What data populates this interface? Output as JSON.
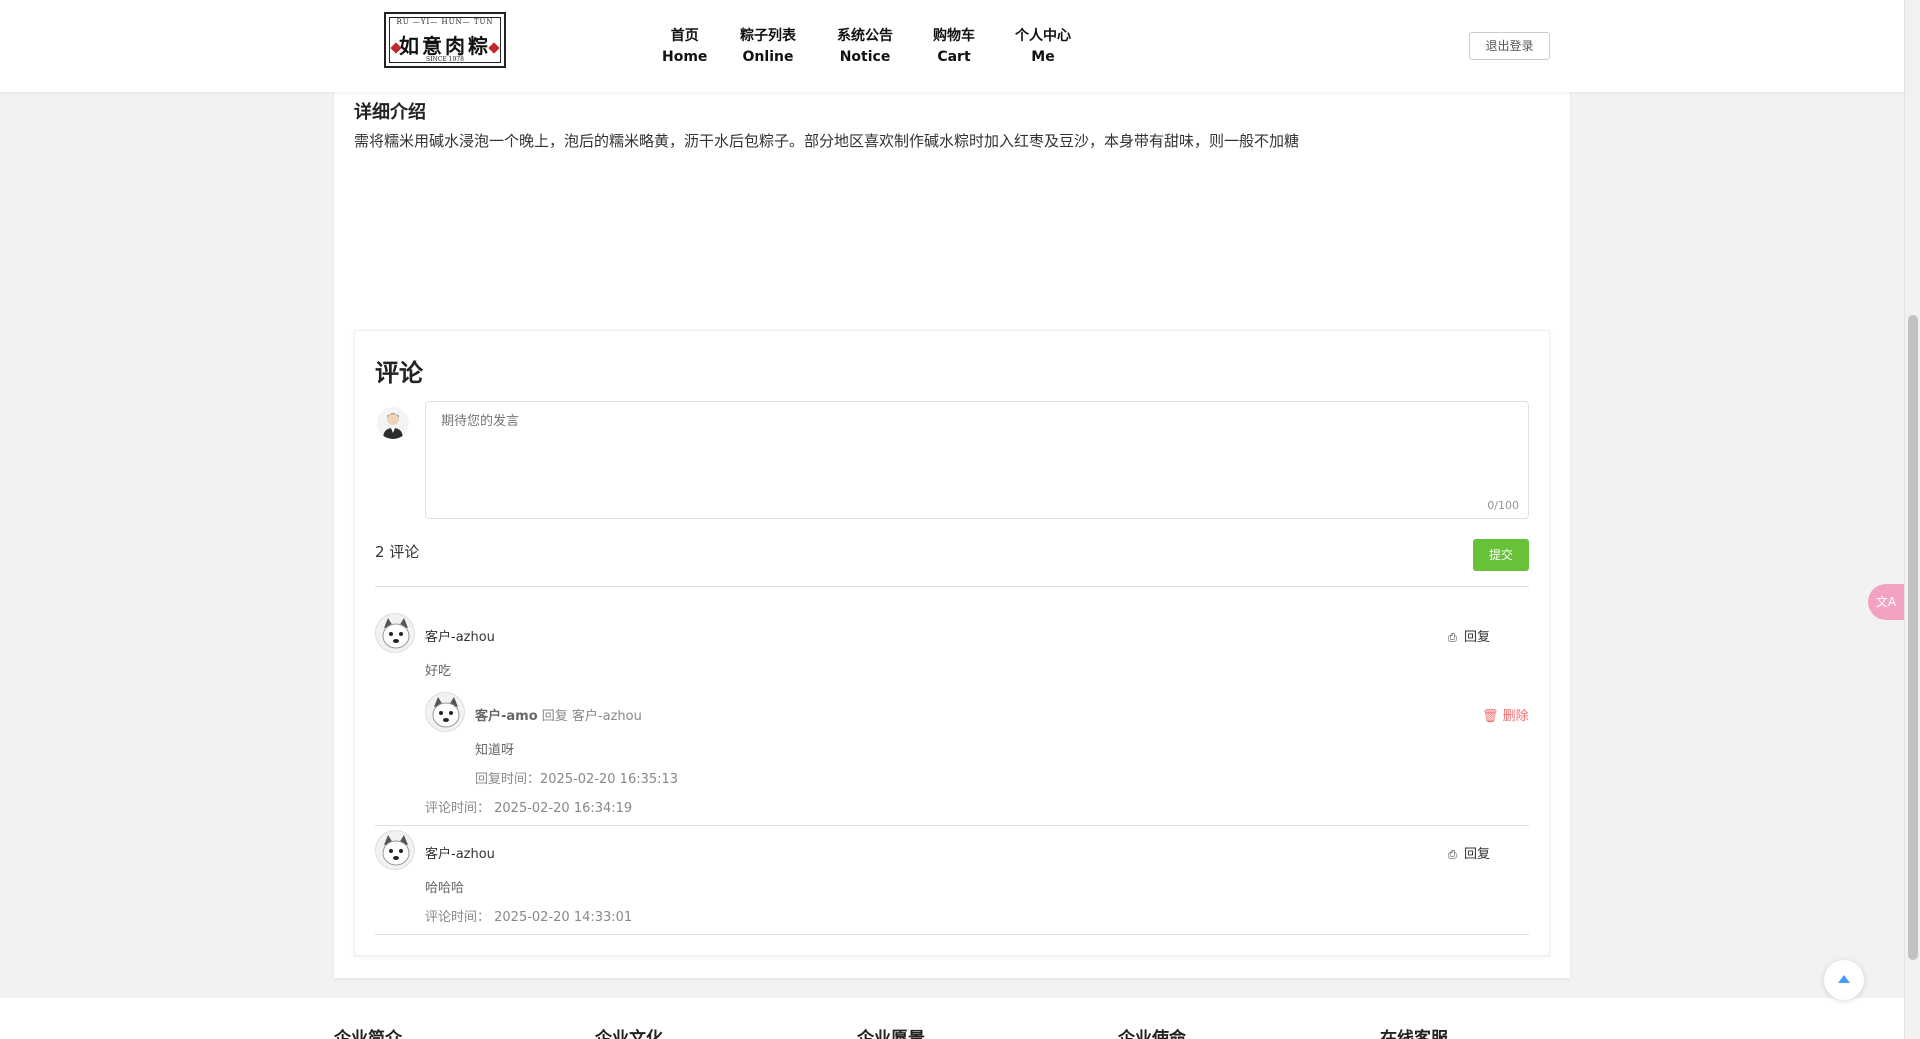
{
  "header": {
    "logo": {
      "top_text": "RU —YI— HUN— TUN",
      "main_text": "如意肉粽",
      "sub_text": "SINCE 1978"
    },
    "nav": [
      {
        "cn": "首页",
        "en": "Home"
      },
      {
        "cn": "粽子列表",
        "en": "Online"
      },
      {
        "cn": "系统公告",
        "en": "Notice"
      },
      {
        "cn": "购物车",
        "en": "Cart"
      },
      {
        "cn": "个人中心",
        "en": "Me"
      }
    ],
    "logout_label": "退出登录"
  },
  "detail": {
    "title": "详细介绍",
    "text": "需将糯米用碱水浸泡一个晚上，泡后的糯米略黄，沥干水后包粽子。部分地区喜欢制作碱水粽时加入红枣及豆沙，本身带有甜味，则一般不加糖"
  },
  "comments": {
    "title": "评论",
    "input_placeholder": "期待您的发言",
    "char_count": "0/100",
    "count_label": "2 评论",
    "submit_label": "提交",
    "reply_label": "回复",
    "delete_label": "删除",
    "items": [
      {
        "user": "客户-azhou",
        "content": "好吃",
        "time": "评论时间： 2025-02-20 16:34:19",
        "reply": {
          "user": "客户-amo",
          "action": " 回复 ",
          "target": "客户-azhou",
          "content": "知道呀",
          "time": "回复时间：2025-02-20 16:35:13"
        }
      },
      {
        "user": "客户-azhou",
        "content": "哈哈哈",
        "time": "评论时间： 2025-02-20 14:33:01"
      }
    ]
  },
  "footer": {
    "items": [
      "企业简介",
      "企业文化",
      "企业愿景",
      "企业使命",
      "在线客服"
    ]
  },
  "widgets": {
    "translate_label": "文A"
  }
}
